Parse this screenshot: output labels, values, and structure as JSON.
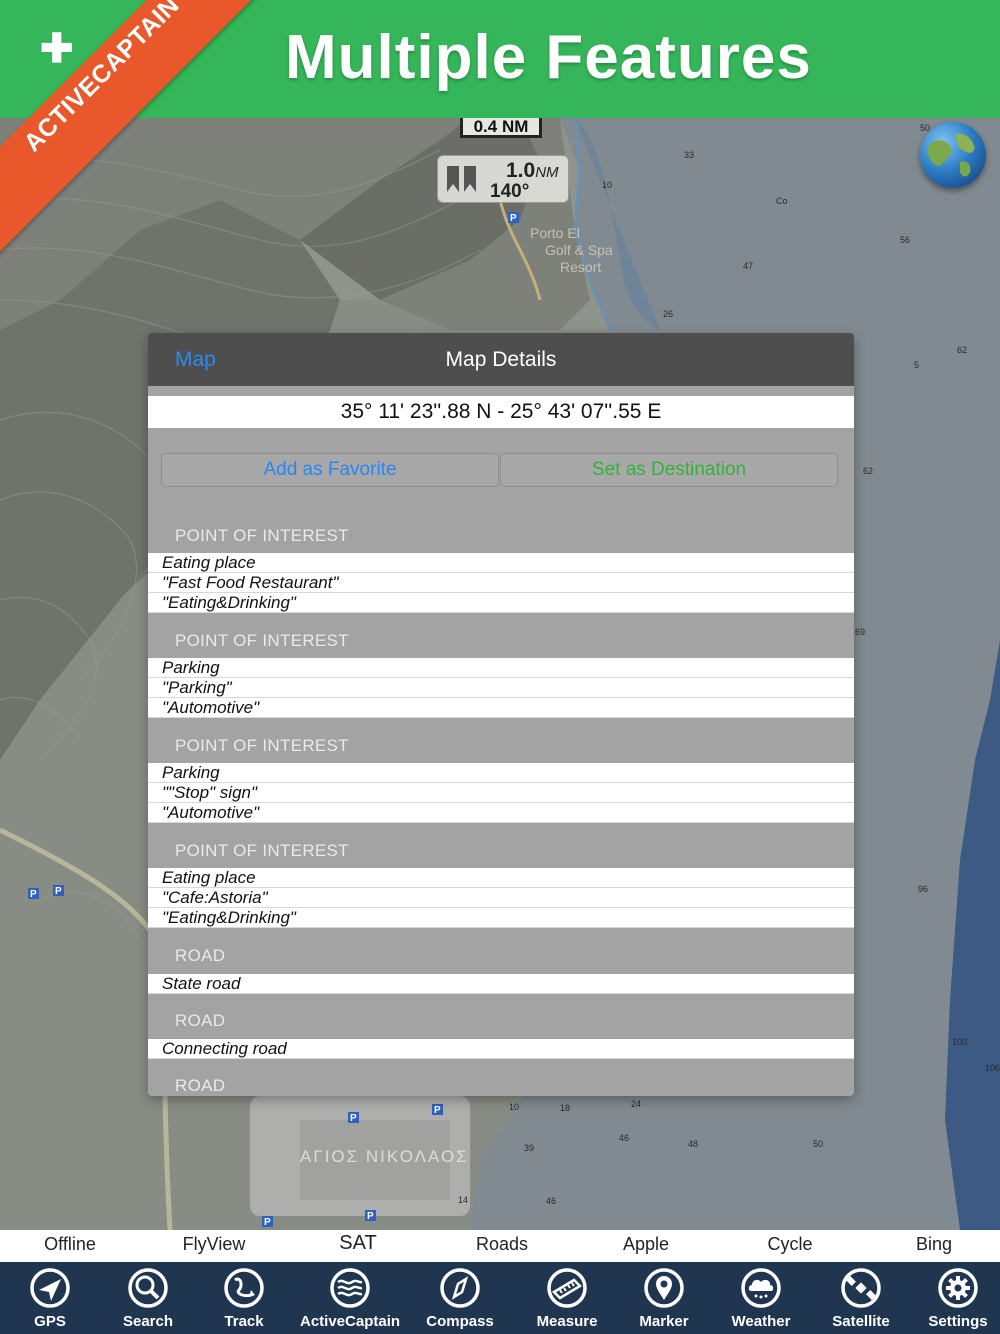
{
  "banner": {
    "title": "Multiple Features",
    "ribbon_text": "ACTIVECAPTAIN",
    "ribbon_icon": "plus-icon"
  },
  "map": {
    "scale": "0.4 NM",
    "distance_value": "1.0",
    "distance_unit": "NM",
    "bearing": "140°",
    "place_label_1": "Porto El",
    "place_label_2": "Golf & Spa",
    "place_label_3": "Resort",
    "town_label_1": "ΑΓΙΟΣ ΝΙΚΟΛΑΟΣ",
    "depths": [
      "50",
      "33",
      "10",
      "Co",
      "56",
      "47",
      "26",
      "62",
      "5",
      "62",
      "69",
      "96",
      "100",
      "106",
      "10",
      "18",
      "24",
      "46",
      "39",
      "48",
      "50",
      "46",
      "14"
    ]
  },
  "panel": {
    "back_label": "Map",
    "title": "Map Details",
    "coordinates": "35° 11' 23''.88 N  -  25° 43' 07''.55 E",
    "favorite_label": "Add as Favorite",
    "destination_label": "Set as Destination",
    "sections": [
      {
        "header": "POINT OF INTEREST",
        "rows": [
          "Eating place",
          "\"Fast Food Restaurant\"",
          "\"Eating&Drinking\""
        ]
      },
      {
        "header": "POINT OF INTEREST",
        "rows": [
          "Parking",
          "\"Parking\"",
          "\"Automotive\""
        ]
      },
      {
        "header": "POINT OF INTEREST",
        "rows": [
          "Parking",
          "\"\"Stop\" sign\"",
          "\"Automotive\""
        ]
      },
      {
        "header": "POINT OF INTEREST",
        "rows": [
          "Eating place",
          "\"Cafe:Astoria\"",
          "\"Eating&Drinking\""
        ]
      },
      {
        "header": "ROAD",
        "rows": [
          "State road"
        ]
      },
      {
        "header": "ROAD",
        "rows": [
          "Connecting road"
        ]
      },
      {
        "header": "ROAD",
        "rows": []
      }
    ]
  },
  "tabs": [
    "Offline",
    "FlyView",
    "SAT",
    "Roads",
    "Apple",
    "Cycle",
    "Bing"
  ],
  "active_tab": "SAT",
  "toolbar": [
    {
      "label": "GPS",
      "icon": "gps-arrow-icon"
    },
    {
      "label": "Search",
      "icon": "magnifier-icon"
    },
    {
      "label": "Track",
      "icon": "track-icon"
    },
    {
      "label": "ActiveCaptain",
      "icon": "waves-icon"
    },
    {
      "label": "Compass",
      "icon": "compass-icon"
    },
    {
      "label": "Measure",
      "icon": "ruler-icon"
    },
    {
      "label": "Marker",
      "icon": "pin-icon"
    },
    {
      "label": "Weather",
      "icon": "cloud-icon"
    },
    {
      "label": "Satellite",
      "icon": "satellite-icon"
    },
    {
      "label": "Settings",
      "icon": "gear-icon"
    }
  ],
  "colors": {
    "banner": "#35b65a",
    "ribbon": "#e8582a",
    "toolbar": "#1f3550",
    "link_blue": "#2b86f0",
    "link_green": "#35b23a"
  }
}
